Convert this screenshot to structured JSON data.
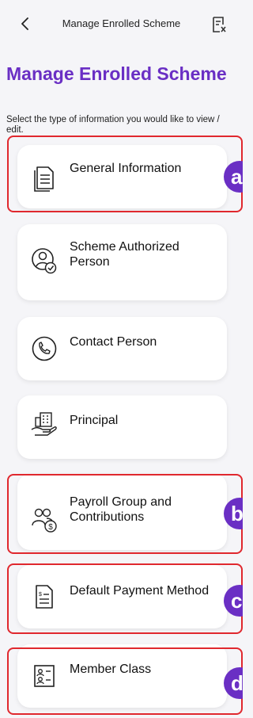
{
  "header": {
    "back_icon": "chevron-left-icon",
    "title": "Manage Enrolled Scheme",
    "action_icon": "document-close-icon"
  },
  "page": {
    "title": "Manage Enrolled Scheme",
    "subtitle": "Select the type of information you would like to view / edit."
  },
  "menu": [
    {
      "label": "General Information",
      "icon": "document-icon",
      "marker": "a"
    },
    {
      "label": "Scheme Authorized Person",
      "icon": "user-check-icon",
      "marker": ""
    },
    {
      "label": "Contact Person",
      "icon": "phone-icon",
      "marker": ""
    },
    {
      "label": "Principal",
      "icon": "building-hand-icon",
      "marker": ""
    },
    {
      "label": "Payroll Group and Contributions",
      "icon": "group-dollar-icon",
      "marker": "b"
    },
    {
      "label": "Default Payment Method",
      "icon": "invoice-icon",
      "marker": "c"
    },
    {
      "label": "Member Class",
      "icon": "member-list-icon",
      "marker": "d"
    }
  ],
  "colors": {
    "accent": "#6a2fc4",
    "highlight": "#e0282e",
    "background": "#f5f5f8"
  }
}
